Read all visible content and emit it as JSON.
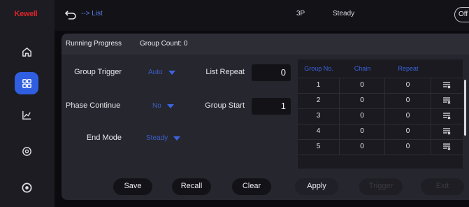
{
  "app": {
    "logo": "Kewell"
  },
  "sidebar": {
    "items": [
      {
        "name": "home",
        "icon": "home-icon",
        "active": false
      },
      {
        "name": "list",
        "icon": "grid-icon",
        "active": true
      },
      {
        "name": "chart",
        "icon": "chart-icon",
        "active": false
      },
      {
        "name": "settings",
        "icon": "settings-icon",
        "active": false
      },
      {
        "name": "logo",
        "icon": "circle-logo-icon",
        "active": false
      }
    ]
  },
  "topbar": {
    "breadcrumb": "--> List",
    "phase": "3P",
    "mode": "Steady",
    "toggle": "Off"
  },
  "panel": {
    "title": "Running Progress",
    "group_count": "Group Count: 0"
  },
  "form": {
    "group_trigger_label": "Group Trigger",
    "group_trigger_value": "Auto",
    "phase_continue_label": "Phase Continue",
    "phase_continue_value": "No",
    "end_mode_label": "End Mode",
    "end_mode_value": "Steady",
    "list_repeat_label": "List Repeat",
    "list_repeat_value": "0",
    "group_start_label": "Group Start",
    "group_start_value": "1"
  },
  "table": {
    "headers": [
      "Group No.",
      "Chain",
      "Repeat"
    ],
    "rows": [
      {
        "group": "1",
        "chain": "0",
        "repeat": "0"
      },
      {
        "group": "2",
        "chain": "0",
        "repeat": "0"
      },
      {
        "group": "3",
        "chain": "0",
        "repeat": "0"
      },
      {
        "group": "4",
        "chain": "0",
        "repeat": "0"
      },
      {
        "group": "5",
        "chain": "0",
        "repeat": "0"
      }
    ]
  },
  "buttons": {
    "save": "Save",
    "recall": "Recall",
    "clear": "Clear",
    "apply": "Apply",
    "trigger": "Trigger",
    "exit": "Exit"
  },
  "colors": {
    "accent": "#2f5ee0",
    "logo_red": "#d8252b",
    "link_blue": "#3d63e0"
  }
}
